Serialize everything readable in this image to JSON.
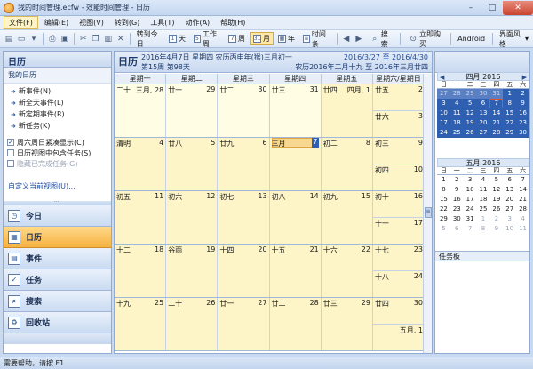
{
  "window": {
    "title": "我的时间管理.ecfw - 效能时间管理 - 日历",
    "minimize": "–",
    "maximize": "□",
    "close": "✕"
  },
  "menu": [
    "文件(F)",
    "编辑(E)",
    "视图(V)",
    "转到(G)",
    "工具(T)",
    "动作(A)",
    "帮助(H)"
  ],
  "toolbar": {
    "goto_today": "转到今日",
    "day1": "1",
    "day_label": "天",
    "week5": "5",
    "workweek_label": "工作周",
    "week7": "7",
    "week_label": "周",
    "month31": "31",
    "month_label": "月",
    "year_label": "年",
    "timeline_label": "时间条",
    "search_label": "搜索",
    "buy_label": "立即购买",
    "android_label": "Android",
    "skin_label": "界面风格"
  },
  "left": {
    "header": "日历",
    "subheader": "我的日历",
    "new_items": [
      "新事件(N)",
      "新全天事件(L)",
      "新定期事件(R)",
      "新任务(K)"
    ],
    "checks": [
      {
        "label": "周六周日紧凑显示(C)",
        "checked": true,
        "disabled": false
      },
      {
        "label": "日历视图中包含任务(S)",
        "checked": false,
        "disabled": false
      },
      {
        "label": "隐藏已完成任务(G)",
        "checked": false,
        "disabled": true
      }
    ],
    "customize_link": "自定义当前视图(U)...",
    "nav": [
      {
        "label": "今日",
        "active": false
      },
      {
        "label": "日历",
        "active": true
      },
      {
        "label": "事件",
        "active": false
      },
      {
        "label": "任务",
        "active": false
      },
      {
        "label": "搜索",
        "active": false
      },
      {
        "label": "回收站",
        "active": false
      }
    ]
  },
  "main": {
    "title": "日历",
    "date_line": "2016年4月7日 星期四 农历丙申年(猴)三月初一",
    "week_line": "第15周 第98天",
    "range": "2016/3/27 至 2016/4/30",
    "lunar_range": "农历2016年二月十九 至 2016年三月廿四",
    "day_headers": [
      "星期一",
      "星期二",
      "星期三",
      "星期四",
      "星期五",
      "星期六/星期日"
    ],
    "weeks": [
      {
        "days": [
          {
            "lun": "二十",
            "d": "三月, 28",
            "cur": false
          },
          {
            "lun": "廿一",
            "d": "29",
            "cur": false
          },
          {
            "lun": "廿二",
            "d": "30",
            "cur": false
          },
          {
            "lun": "廿三",
            "d": "31",
            "cur": false
          },
          {
            "lun": "廿四",
            "d": "四月, 1",
            "cur": true
          }
        ],
        "wkend": [
          {
            "lun": "廿五",
            "d": "2"
          },
          {
            "lun": "廿六",
            "d": "3"
          }
        ]
      },
      {
        "days": [
          {
            "lun": "清明",
            "d": "4",
            "cur": true
          },
          {
            "lun": "廿八",
            "d": "5",
            "cur": true
          },
          {
            "lun": "廿九",
            "d": "6",
            "cur": true
          },
          {
            "lun": "三月",
            "d": "7",
            "cur": true,
            "today": true
          },
          {
            "lun": "初二",
            "d": "8",
            "cur": true
          }
        ],
        "wkend": [
          {
            "lun": "初三",
            "d": "9"
          },
          {
            "lun": "初四",
            "d": "10"
          }
        ]
      },
      {
        "days": [
          {
            "lun": "初五",
            "d": "11",
            "cur": true
          },
          {
            "lun": "初六",
            "d": "12",
            "cur": true
          },
          {
            "lun": "初七",
            "d": "13",
            "cur": true
          },
          {
            "lun": "初八",
            "d": "14",
            "cur": true
          },
          {
            "lun": "初九",
            "d": "15",
            "cur": true
          }
        ],
        "wkend": [
          {
            "lun": "初十",
            "d": "16"
          },
          {
            "lun": "十一",
            "d": "17"
          }
        ]
      },
      {
        "days": [
          {
            "lun": "十二",
            "d": "18",
            "cur": true
          },
          {
            "lun": "谷雨",
            "d": "19",
            "cur": true
          },
          {
            "lun": "十四",
            "d": "20",
            "cur": true
          },
          {
            "lun": "十五",
            "d": "21",
            "cur": true
          },
          {
            "lun": "十六",
            "d": "22",
            "cur": true
          }
        ],
        "wkend": [
          {
            "lun": "十七",
            "d": "23"
          },
          {
            "lun": "十八",
            "d": "24"
          }
        ]
      },
      {
        "days": [
          {
            "lun": "十九",
            "d": "25",
            "cur": true
          },
          {
            "lun": "二十",
            "d": "26",
            "cur": true
          },
          {
            "lun": "廿一",
            "d": "27",
            "cur": true
          },
          {
            "lun": "廿二",
            "d": "28",
            "cur": true
          },
          {
            "lun": "廿三",
            "d": "29",
            "cur": true
          }
        ],
        "wkend": [
          {
            "lun": "廿四",
            "d": "30"
          },
          {
            "lun": "",
            "d": "五月, 1"
          }
        ]
      }
    ]
  },
  "right": {
    "april": {
      "title": "四月 2016",
      "dow": [
        "日",
        "一",
        "二",
        "三",
        "四",
        "五",
        "六"
      ],
      "days": [
        {
          "t": "27",
          "c": "selo"
        },
        {
          "t": "28",
          "c": "selo"
        },
        {
          "t": "29",
          "c": "selo"
        },
        {
          "t": "30",
          "c": "selo"
        },
        {
          "t": "31",
          "c": "selo"
        },
        {
          "t": "1",
          "c": "sel"
        },
        {
          "t": "2",
          "c": "sel"
        },
        {
          "t": "3",
          "c": "sel"
        },
        {
          "t": "4",
          "c": "sel"
        },
        {
          "t": "5",
          "c": "sel"
        },
        {
          "t": "6",
          "c": "sel"
        },
        {
          "t": "7",
          "c": "today"
        },
        {
          "t": "8",
          "c": "sel"
        },
        {
          "t": "9",
          "c": "sel"
        },
        {
          "t": "10",
          "c": "sel"
        },
        {
          "t": "11",
          "c": "sel"
        },
        {
          "t": "12",
          "c": "sel"
        },
        {
          "t": "13",
          "c": "sel"
        },
        {
          "t": "14",
          "c": "sel"
        },
        {
          "t": "15",
          "c": "sel"
        },
        {
          "t": "16",
          "c": "sel"
        },
        {
          "t": "17",
          "c": "sel"
        },
        {
          "t": "18",
          "c": "sel"
        },
        {
          "t": "19",
          "c": "sel"
        },
        {
          "t": "20",
          "c": "sel"
        },
        {
          "t": "21",
          "c": "sel"
        },
        {
          "t": "22",
          "c": "sel"
        },
        {
          "t": "23",
          "c": "sel"
        },
        {
          "t": "24",
          "c": "sel"
        },
        {
          "t": "25",
          "c": "sel"
        },
        {
          "t": "26",
          "c": "sel"
        },
        {
          "t": "27",
          "c": "sel"
        },
        {
          "t": "28",
          "c": "sel"
        },
        {
          "t": "29",
          "c": "sel"
        },
        {
          "t": "30",
          "c": "sel"
        }
      ]
    },
    "may": {
      "title": "五月 2016",
      "dow": [
        "日",
        "一",
        "二",
        "三",
        "四",
        "五",
        "六"
      ],
      "days": [
        {
          "t": "1",
          "c": ""
        },
        {
          "t": "2",
          "c": ""
        },
        {
          "t": "3",
          "c": ""
        },
        {
          "t": "4",
          "c": ""
        },
        {
          "t": "5",
          "c": ""
        },
        {
          "t": "6",
          "c": ""
        },
        {
          "t": "7",
          "c": ""
        },
        {
          "t": "8",
          "c": ""
        },
        {
          "t": "9",
          "c": ""
        },
        {
          "t": "10",
          "c": ""
        },
        {
          "t": "11",
          "c": ""
        },
        {
          "t": "12",
          "c": ""
        },
        {
          "t": "13",
          "c": ""
        },
        {
          "t": "14",
          "c": ""
        },
        {
          "t": "15",
          "c": ""
        },
        {
          "t": "16",
          "c": ""
        },
        {
          "t": "17",
          "c": ""
        },
        {
          "t": "18",
          "c": ""
        },
        {
          "t": "19",
          "c": ""
        },
        {
          "t": "20",
          "c": ""
        },
        {
          "t": "21",
          "c": ""
        },
        {
          "t": "22",
          "c": ""
        },
        {
          "t": "23",
          "c": ""
        },
        {
          "t": "24",
          "c": ""
        },
        {
          "t": "25",
          "c": ""
        },
        {
          "t": "26",
          "c": ""
        },
        {
          "t": "27",
          "c": ""
        },
        {
          "t": "28",
          "c": ""
        },
        {
          "t": "29",
          "c": ""
        },
        {
          "t": "30",
          "c": ""
        },
        {
          "t": "31",
          "c": ""
        },
        {
          "t": "1",
          "c": "other"
        },
        {
          "t": "2",
          "c": "other"
        },
        {
          "t": "3",
          "c": "other"
        },
        {
          "t": "4",
          "c": "other"
        },
        {
          "t": "5",
          "c": "other"
        },
        {
          "t": "6",
          "c": "other"
        },
        {
          "t": "7",
          "c": "other"
        },
        {
          "t": "8",
          "c": "other"
        },
        {
          "t": "9",
          "c": "other"
        },
        {
          "t": "10",
          "c": "other"
        },
        {
          "t": "11",
          "c": "other"
        }
      ]
    },
    "taskpad": "任务板"
  },
  "status": "需要帮助，请按 F1"
}
